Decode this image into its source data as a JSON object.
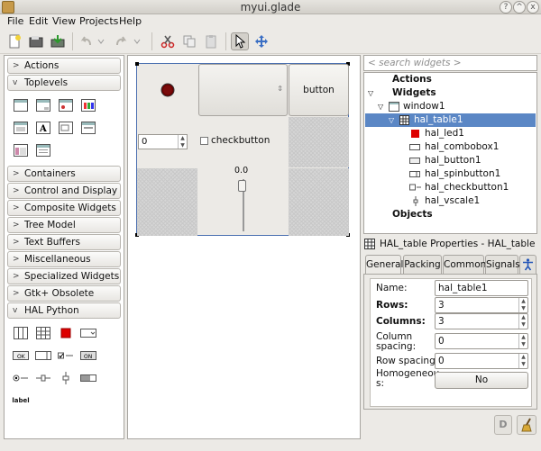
{
  "window": {
    "title": "myui.glade"
  },
  "menu": {
    "file": "File",
    "edit": "Edit",
    "view": "View",
    "projects": "Projects",
    "help": "Help"
  },
  "palette": {
    "categories": {
      "actions": "Actions",
      "toplevels": "Toplevels",
      "containers": "Containers",
      "control": "Control and Display",
      "composite": "Composite Widgets",
      "treemodel": "Tree Model",
      "textbuffers": "Text Buffers",
      "misc": "Miscellaneous",
      "specialized": "Specialized Widgets",
      "obsolete": "Gtk+ Obsolete",
      "halpython": "HAL Python"
    },
    "hal_label_icon": "label",
    "button_mini": "OK",
    "on_mini": "ON"
  },
  "design": {
    "button": "button",
    "spin_value": "0",
    "checkbutton": "checkbutton",
    "scale_value": "0.0"
  },
  "inspector": {
    "search_placeholder": "< search widgets >",
    "actions": "Actions",
    "widgets": "Widgets",
    "window1": "window1",
    "hal_table1": "hal_table1",
    "hal_led1": "hal_led1",
    "hal_combobox1": "hal_combobox1",
    "hal_button1": "hal_button1",
    "hal_spinbutton1": "hal_spinbutton1",
    "hal_checkbutton1": "hal_checkbutton1",
    "hal_vscale1": "hal_vscale1",
    "objects": "Objects"
  },
  "properties": {
    "header": "HAL_table Properties - HAL_table [hal_table1]",
    "tabs": {
      "general": "General",
      "packing": "Packing",
      "common": "Common",
      "signals": "Signals"
    },
    "name_label": "Name:",
    "name_value": "hal_table1",
    "rows_label": "Rows:",
    "rows_value": "3",
    "columns_label": "Columns:",
    "columns_value": "3",
    "colspacing_label1": "Column",
    "colspacing_label2": "spacing:",
    "colspacing_value": "0",
    "rowspacing_label": "Row spacing:",
    "rowspacing_value": "0",
    "homogeneous_label1": "Homogeneou",
    "homogeneous_label2": "s:",
    "homogeneous_value": "No"
  },
  "bottom": {
    "d_icon": "D"
  },
  "colors": {
    "selection": "#5b87c5",
    "led": "#cc0000"
  }
}
